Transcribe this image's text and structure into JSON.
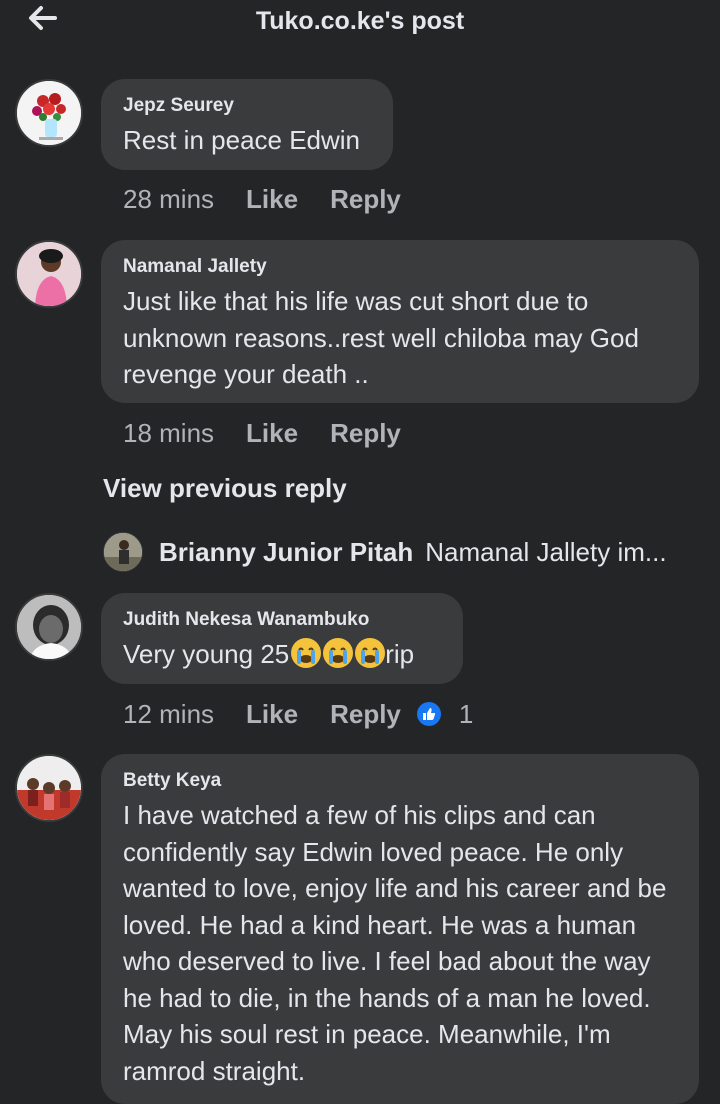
{
  "header": {
    "title": "Tuko.co.ke's post"
  },
  "comments": [
    {
      "author": "Jepz Seurey",
      "text": "Rest in peace Edwin",
      "time": "28 mins",
      "like": "Like",
      "reply": "Reply"
    },
    {
      "author": "Namanal Jallety",
      "text": "Just like that his life was cut short due to unknown reasons..rest well chiloba may God revenge your death ..",
      "time": "18 mins",
      "like": "Like",
      "reply": "Reply"
    },
    {
      "author": "Judith Nekesa Wanambuko",
      "text_before": "Very young 25",
      "text_after": "rip",
      "time": "12 mins",
      "like": "Like",
      "reply": "Reply",
      "reaction_count": "1"
    },
    {
      "author": "Betty Keya",
      "text": "I have watched a few of his clips and can confidently say Edwin loved peace. He only wanted to love, enjoy life and his career and be loved. He had a kind heart. He was a human who deserved to live. I feel bad about the way he had to die, in the hands of a man he loved. May his soul rest in peace. Meanwhile, I'm ramrod straight."
    }
  ],
  "view_previous": "View previous reply",
  "reply_preview": {
    "author": "Brianny Junior Pitah",
    "text": "Namanal Jallety im..."
  },
  "icons": {
    "back": "back-arrow-icon",
    "like_reaction": "thumbs-up-icon",
    "emoji": "loudly-crying-face-emoji"
  },
  "colors": {
    "background": "#242526",
    "bubble": "#3a3b3c",
    "secondary_text": "#b0b3b8",
    "like_blue": "#1877f2"
  }
}
